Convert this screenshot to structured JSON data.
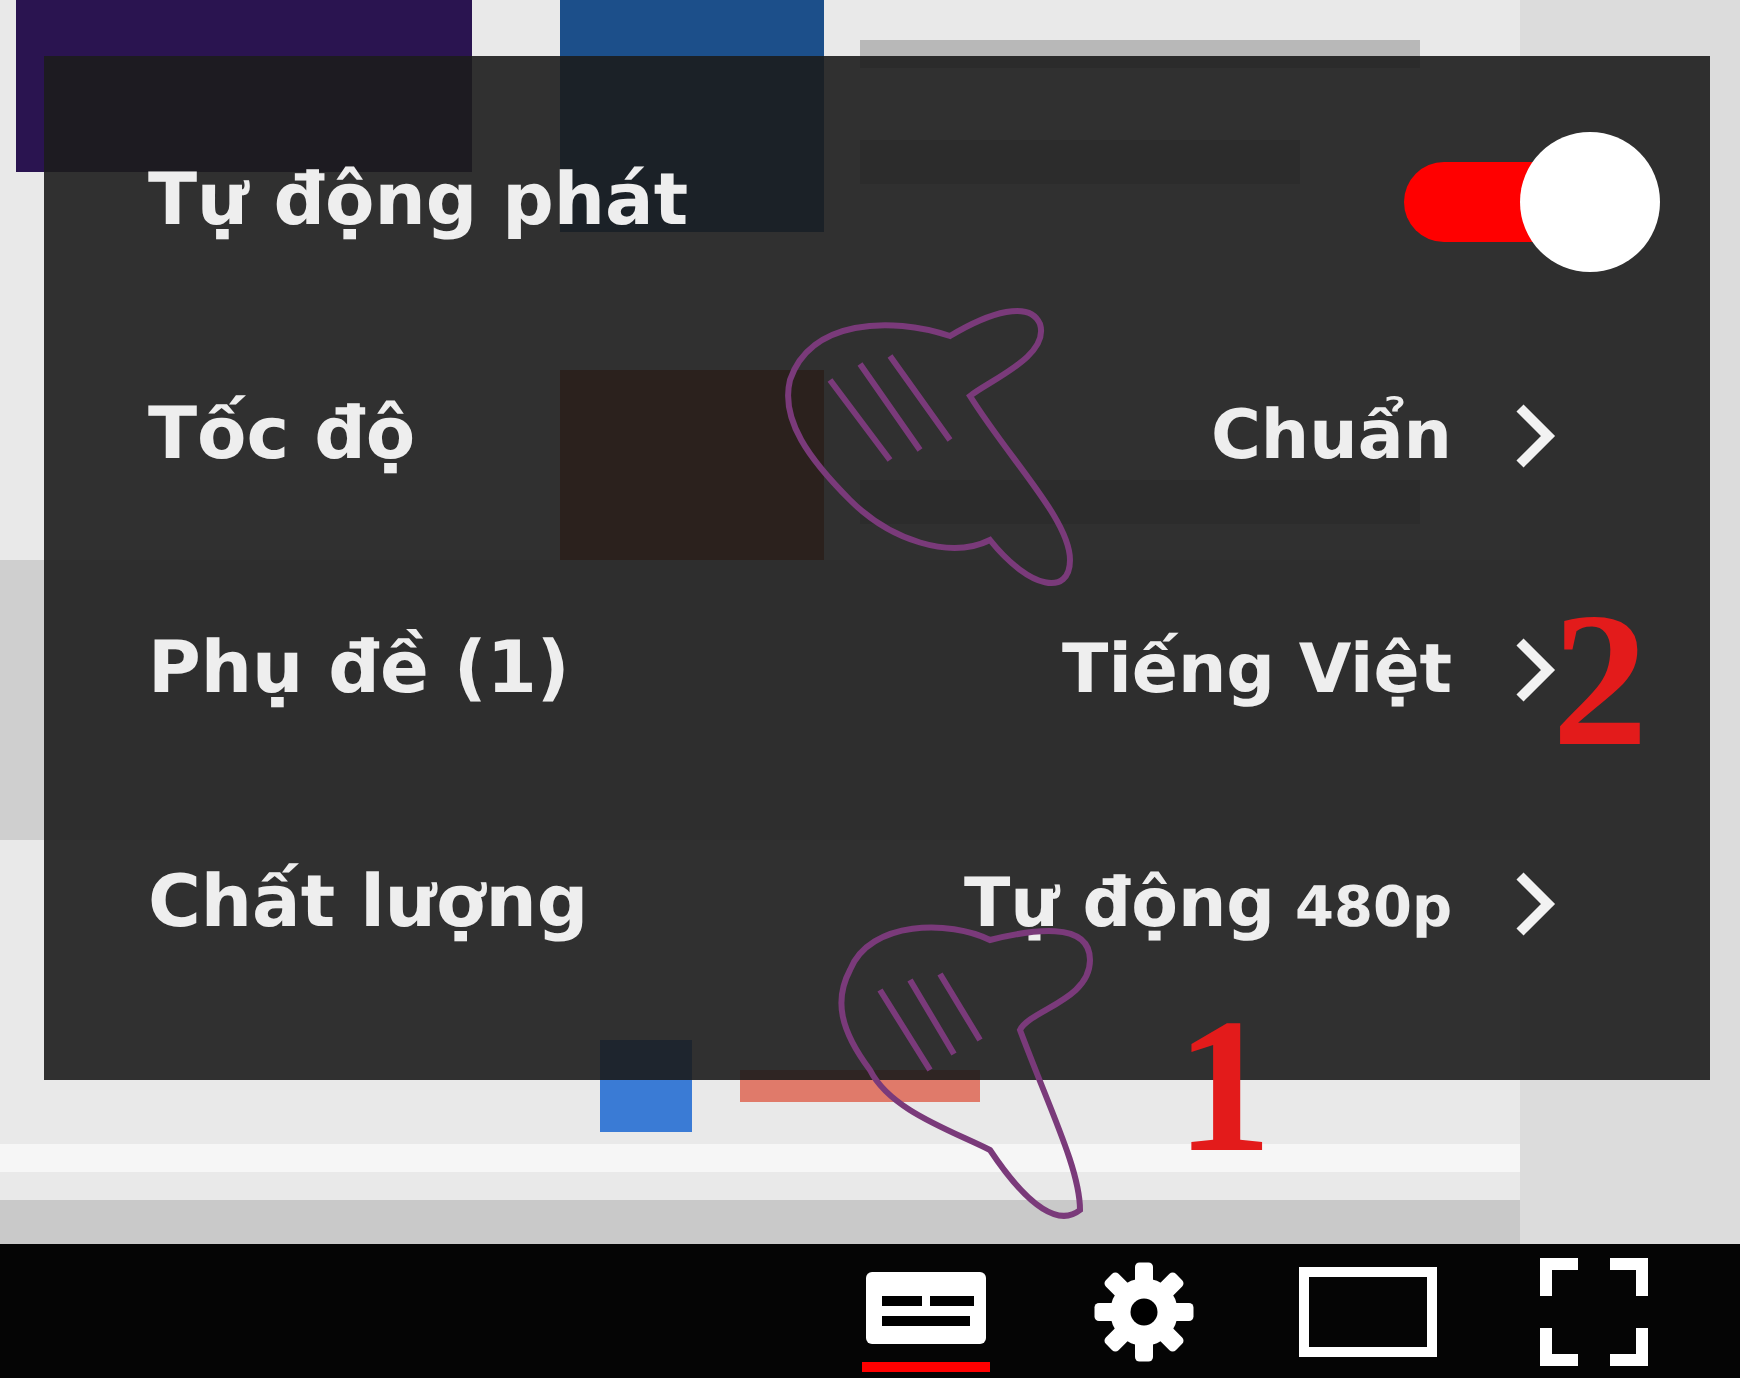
{
  "menu": {
    "items": [
      {
        "kind": "toggle",
        "label": "Tự động phát",
        "on": true
      },
      {
        "kind": "submenu",
        "label": "Tốc độ",
        "value": "Chuẩn"
      },
      {
        "kind": "submenu",
        "label": "Phụ đề (1)",
        "value": "Tiếng Việt"
      },
      {
        "kind": "submenu",
        "label": "Chất lượng",
        "value": "Tự động",
        "detail": "480p"
      }
    ]
  },
  "player_controls": {
    "subtitles_on": true
  },
  "annotations": [
    "1",
    "2"
  ]
}
